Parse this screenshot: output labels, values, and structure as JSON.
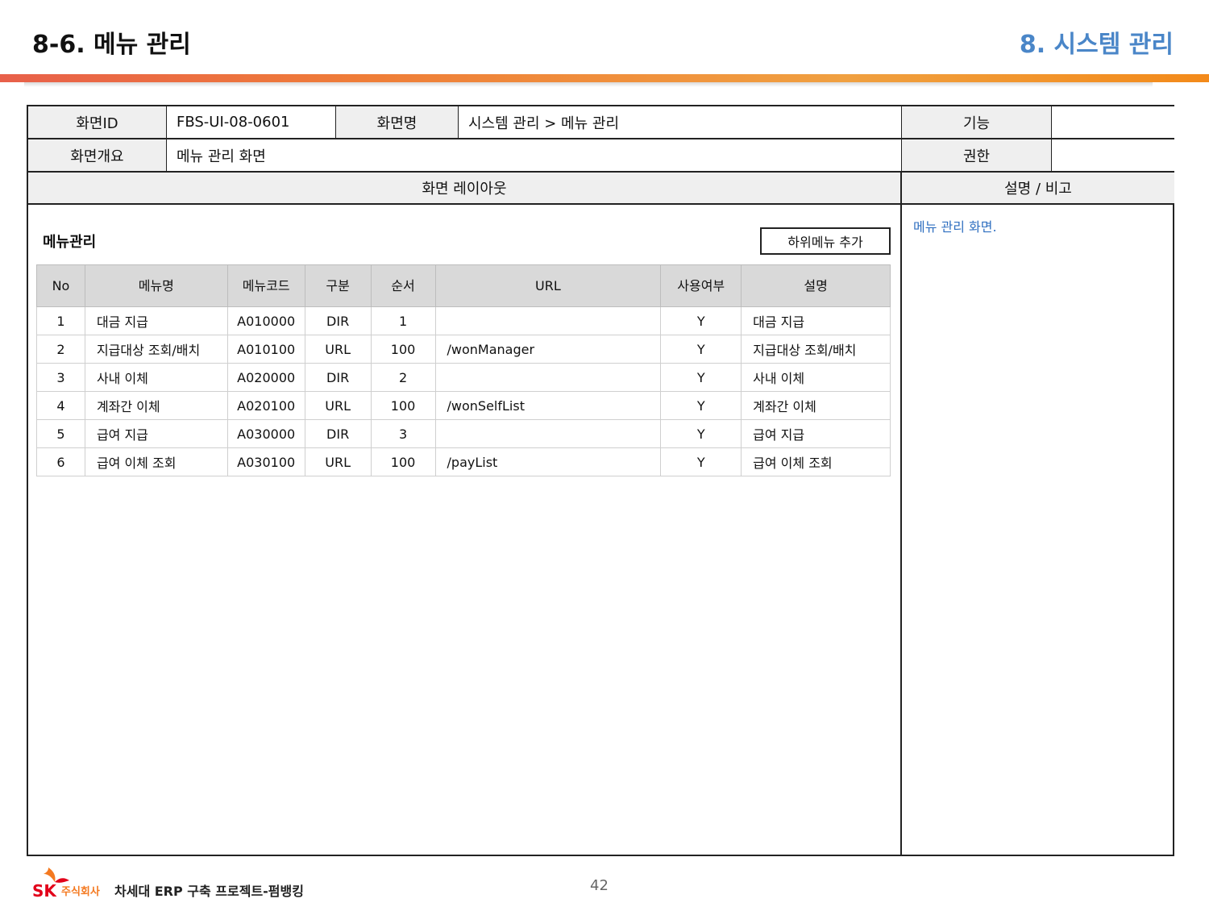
{
  "header": {
    "page_title": "8-6. 메뉴 관리",
    "section_title": "8. 시스템 관리"
  },
  "spec": {
    "screen_id_label": "화면ID",
    "screen_id_value": "FBS-UI-08-0601",
    "screen_name_label": "화면명",
    "screen_name_value": "시스템 관리 > 메뉴 관리",
    "function_label": "기능",
    "function_value": "",
    "overview_label": "화면개요",
    "overview_value": "메뉴 관리 화면",
    "permission_label": "권한",
    "permission_value": "",
    "layout_label": "화면 레이아웃",
    "desc_label": "설명 / 비고",
    "desc_text": "메뉴 관리 화면."
  },
  "menu": {
    "heading": "메뉴관리",
    "add_button": "하위메뉴 추가",
    "columns": [
      "No",
      "메뉴명",
      "메뉴코드",
      "구분",
      "순서",
      "URL",
      "사용여부",
      "설명"
    ],
    "rows": [
      [
        "1",
        "대금 지급",
        "A010000",
        "DIR",
        "1",
        "",
        "Y",
        "대금 지급"
      ],
      [
        "2",
        "지급대상 조회/배치",
        "A010100",
        "URL",
        "100",
        "/wonManager",
        "Y",
        "지급대상 조회/배치"
      ],
      [
        "3",
        "사내 이체",
        "A020000",
        "DIR",
        "2",
        "",
        "Y",
        "사내 이체"
      ],
      [
        "4",
        "계좌간 이체",
        "A020100",
        "URL",
        "100",
        "/wonSelfList",
        "Y",
        "계좌간 이체"
      ],
      [
        "5",
        "급여 지급",
        "A030000",
        "DIR",
        "3",
        "",
        "Y",
        "급여 지급"
      ],
      [
        "6",
        "급여 이체 조회",
        "A030100",
        "URL",
        "100",
        "/payList",
        "Y",
        "급여 이체 조회"
      ]
    ]
  },
  "footer": {
    "logo_text": "SK",
    "company": "주식회사",
    "project": "차세대 ERP 구축 프로젝트-펌뱅킹",
    "page_number": "42"
  },
  "colors": {
    "accent_blue": "#4a86c8",
    "header_orange": "#f38a1a",
    "sk_red": "#e2001a",
    "sk_orange": "#f47920"
  }
}
